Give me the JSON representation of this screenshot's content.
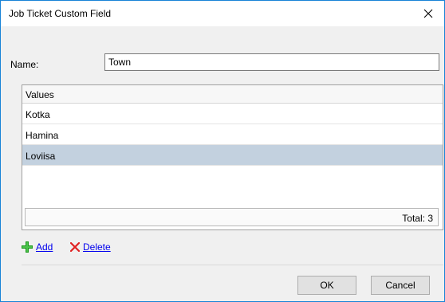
{
  "window": {
    "title": "Job Ticket Custom Field"
  },
  "form": {
    "name_label": "Name:",
    "name_value": "Town"
  },
  "grid": {
    "header": "Values",
    "rows": [
      "Kotka",
      "Hamina",
      "Loviisa"
    ],
    "selected_row": "Loviisa",
    "footer": "Total: 3"
  },
  "actions": {
    "add_label": "Add",
    "delete_label": "Delete"
  },
  "buttons": {
    "ok": "OK",
    "cancel": "Cancel"
  },
  "colors": {
    "selection": "#c3d1df",
    "add_icon": "#1f9a1f",
    "delete_icon": "#e02020",
    "link": "#0000ee",
    "border_accent": "#1883d7"
  },
  "icons": {
    "add": "green-plus-icon",
    "delete": "red-x-icon",
    "close": "close-icon"
  }
}
